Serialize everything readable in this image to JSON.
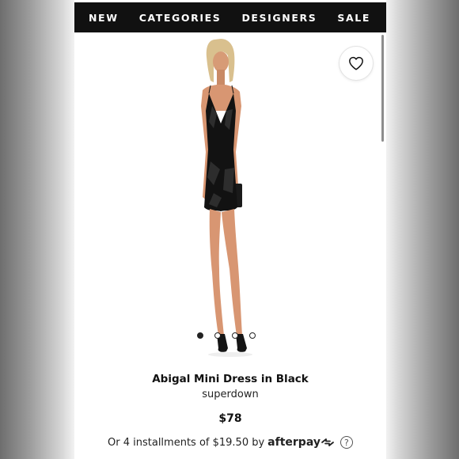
{
  "nav": {
    "items": [
      {
        "label": "NEW"
      },
      {
        "label": "CATEGORIES"
      },
      {
        "label": "DESIGNERS"
      },
      {
        "label": "SALE"
      }
    ]
  },
  "product": {
    "title": "Abigal Mini Dress in Black",
    "brand": "superdown",
    "price": "$78",
    "image_count": 4,
    "active_image": 1
  },
  "installments": {
    "text": "Or 4 installments of $19.50 by",
    "provider": "afterpay",
    "info_symbol": "?"
  },
  "icons": {
    "favorite": "heart-icon",
    "afterpay": "afterpay-arrows-icon",
    "info": "info-circle-icon"
  },
  "colors": {
    "navbar": "#111111",
    "text": "#111111",
    "page": "#ffffff"
  }
}
